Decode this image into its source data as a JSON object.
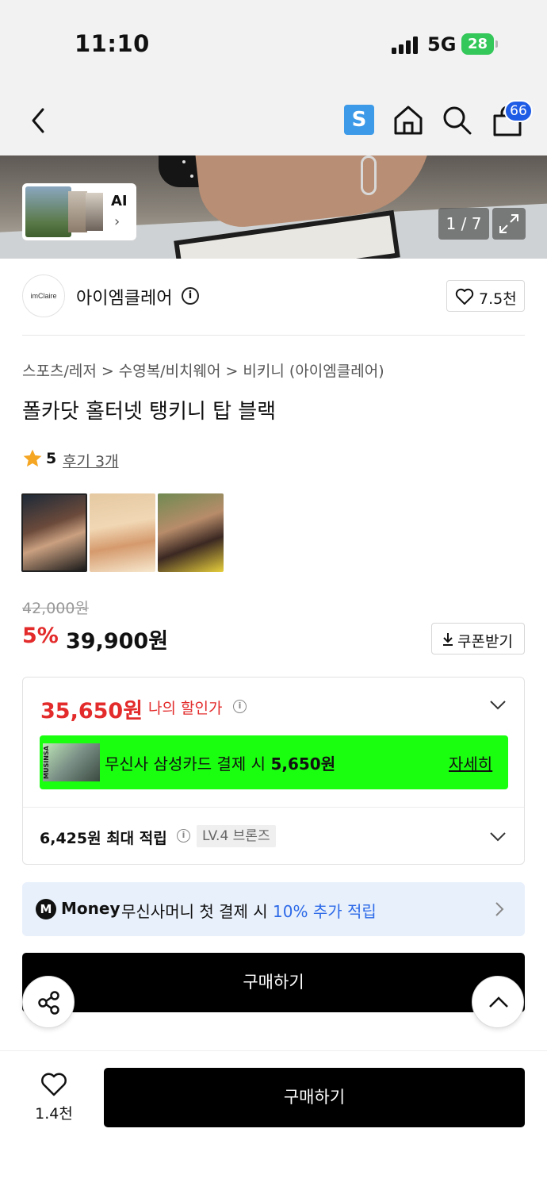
{
  "status": {
    "time": "11:10",
    "network": "5G",
    "battery": "28"
  },
  "nav": {
    "s_badge": "S",
    "cart_count": "66"
  },
  "gallery": {
    "ai_label": "AI",
    "counter": "1 / 7"
  },
  "brand": {
    "logo_text": "imClaire",
    "name": "아이엠클레어",
    "like_count": "7.5천"
  },
  "breadcrumb": [
    "스포츠/레저",
    "수영복/비치웨어",
    "비키니 (아이엠클레어)"
  ],
  "product": {
    "title": "폴카닷 홀터넷 탱키니 탑 블랙",
    "rating": "5",
    "review_link": "후기 3개"
  },
  "price": {
    "original": "42,000원",
    "discount_rate": "5%",
    "sale": "39,900원",
    "coupon_label": "쿠폰받기"
  },
  "discount_box": {
    "my_price": "35,650원",
    "my_price_label": "나의 할인가",
    "card_image_text": "MUSINSA",
    "card_text_prefix": "무신사 삼성카드 결제 시 ",
    "card_amount": "5,650원",
    "card_detail": "자세히",
    "points_text": "6,425원 최대 적립",
    "level": "LV.4 브론즈"
  },
  "money_banner": {
    "icon": "M",
    "brand": "Money",
    "text": "무신사머니 첫 결제 시 ",
    "highlight": "10% 추가 적립"
  },
  "buttons": {
    "buy_inline": "구매하기",
    "buy_bottom": "구매하기"
  },
  "bottom": {
    "like_count": "1.4천"
  },
  "colors": {
    "sale_red": "#e32b2b",
    "card_green": "#1aff0f",
    "money_blue": "#2d6ae8",
    "cart_badge": "#1f5ce6"
  }
}
